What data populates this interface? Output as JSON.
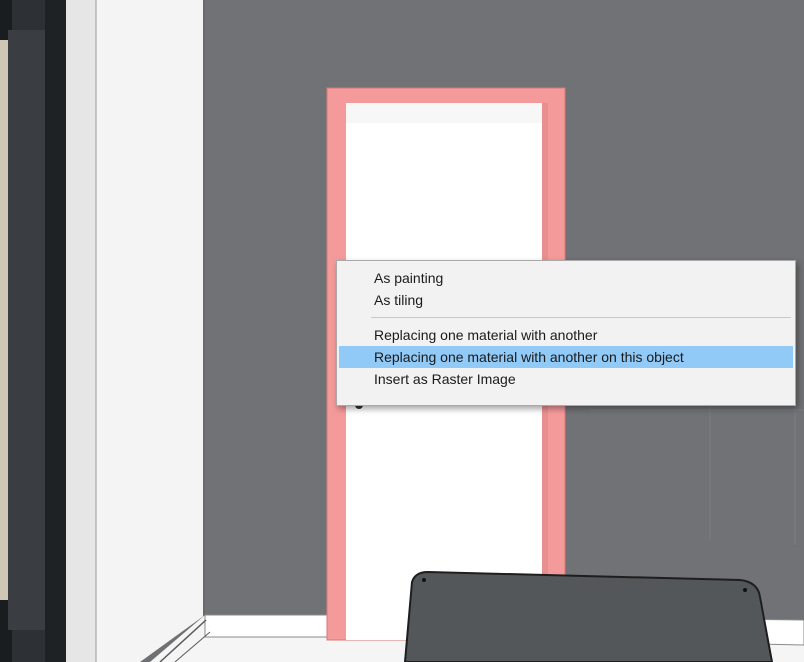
{
  "context_menu": {
    "items": [
      {
        "label": "As painting"
      },
      {
        "label": "As tiling"
      },
      {
        "label": "Replacing one material with another"
      },
      {
        "label": "Replacing one material with another on this object"
      },
      {
        "label": "Insert as Raster Image"
      }
    ],
    "highlighted": "Replacing one material with another on this object"
  },
  "colors": {
    "wall": "#6e7073",
    "door_frame_highlight": "#f59a9a",
    "door_panel": "#ffffff",
    "menu_highlight": "#91c9f7",
    "chair": "#55595b"
  }
}
